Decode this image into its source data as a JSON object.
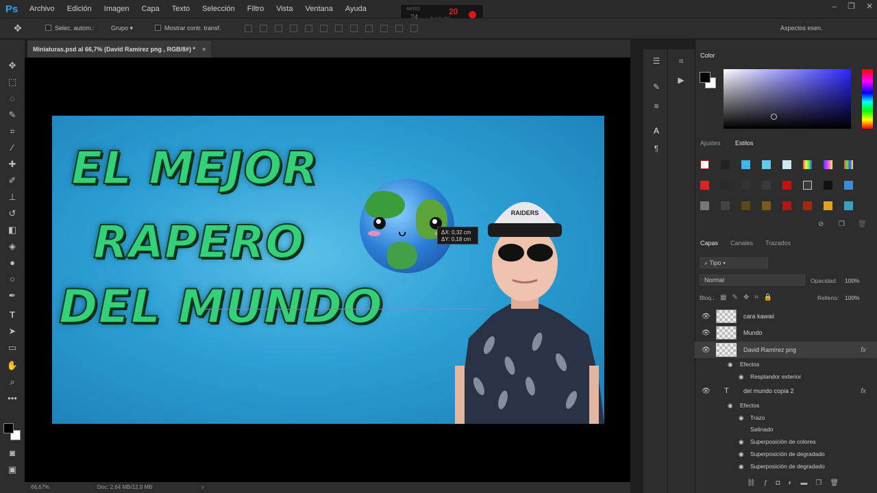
{
  "app": {
    "logo": "Ps"
  },
  "menu": [
    "Archivo",
    "Edición",
    "Imagen",
    "Capa",
    "Texto",
    "Selección",
    "Filtro",
    "Vista",
    "Ventana",
    "Ayuda"
  ],
  "recorder": {
    "top_text": "AERO",
    "counter": "20",
    "fps": "24",
    "time": "0:10:39"
  },
  "options": {
    "auto_select_label": "Selec. autom.:",
    "group_value": "Grupo",
    "show_transform_label": "Mostrar contr. transf.",
    "workspace": "Aspectos esen."
  },
  "document": {
    "tab_title": "Miniaturas.psd al 66,7% (David Ramírez png , RGB/8#) *",
    "close": "×"
  },
  "artwork": {
    "line1": "EL MEJOR",
    "line2": "RAPERO",
    "line3": "DEL MUNDO",
    "cap_logo": "RAIDERS",
    "face": "ᴗ"
  },
  "move_tooltip": {
    "dx": "0,32 cm",
    "dy": "0,18 cm",
    "dx_label": "ΔX:",
    "dy_label": "ΔY:"
  },
  "status": {
    "zoom": "66,67%",
    "doc": "Doc: 2,64 MB/12,9 MB",
    "arrow": "›"
  },
  "colors": {
    "accent": "#2fa3f7",
    "text_fill": "#35d17a",
    "fg_swatch": "#000000",
    "bg_swatch": "#ffffff"
  },
  "panels": {
    "color_tab": "Color",
    "tabs_mid": [
      "Ajustes",
      "Estilos"
    ],
    "tabs_layers": [
      "Capas",
      "Canales",
      "Trazados"
    ],
    "filter_kind": "Tipo",
    "blend_mode": "Normal",
    "opacity_label": "Opacidad:",
    "opacity_value": "100%",
    "lock_label": "Bloq.:",
    "fill_label": "Relleno:",
    "fill_value": "100%"
  },
  "layers": [
    {
      "name": "cara kawaii",
      "type": "image"
    },
    {
      "name": "Mundo",
      "type": "image"
    },
    {
      "name": "David Ramírez png",
      "type": "image",
      "selected": true,
      "fx": "fx"
    },
    {
      "name": "del mundo copia 2",
      "type": "text",
      "fx": "fx"
    }
  ],
  "effects": {
    "david": {
      "header": "Efectos",
      "items": [
        "Resplandor exterior"
      ]
    },
    "text": {
      "header": "Efectos",
      "items": [
        "Trazo",
        "Satinado",
        "Superposición de colores",
        "Superposición de degradado",
        "Superposición de degradado"
      ]
    }
  },
  "icons": {
    "toolbar": [
      "move-icon",
      "marquee-icon",
      "lasso-icon",
      "quick-select-icon",
      "crop-icon",
      "eyedropper-icon",
      "healing-icon",
      "brush-icon",
      "stamp-icon",
      "history-brush-icon",
      "eraser-icon",
      "gradient-icon",
      "blur-icon",
      "dodge-icon",
      "pen-icon",
      "type-icon",
      "path-select-icon",
      "rectangle-icon",
      "hand-icon",
      "zoom-icon",
      "more-icon"
    ]
  }
}
